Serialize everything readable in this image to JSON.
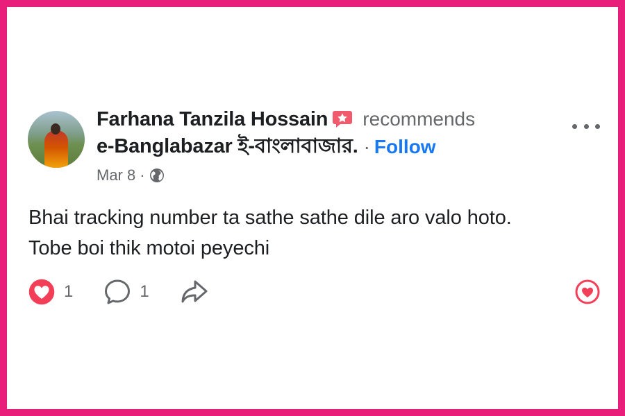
{
  "post": {
    "author_name": "Farhana Tanzila Hossain",
    "action_text": "recommends",
    "page_name": "e-Banglabazar ই-বাংলাবাজার.",
    "separator": "·",
    "follow_label": "Follow",
    "date": "Mar 8",
    "privacy_separator": "·",
    "privacy_icon": "globe-icon",
    "recommend_icon": "recommend-star-icon",
    "text_line1": "Bhai tracking number ta sathe sathe dile aro valo hoto.",
    "text_line2": "Tobe boi thik motoi peyechi"
  },
  "actions": {
    "love_count": "1",
    "comment_count": "1",
    "love_icon": "heart-reaction-icon",
    "comment_icon": "comment-icon",
    "share_icon": "share-icon",
    "react_icon": "heart-outline-icon"
  },
  "colors": {
    "frame": "#e91e7a",
    "follow": "#1877f2",
    "love": "#f33e58",
    "muted": "#65676b",
    "text": "#1c1e21"
  }
}
